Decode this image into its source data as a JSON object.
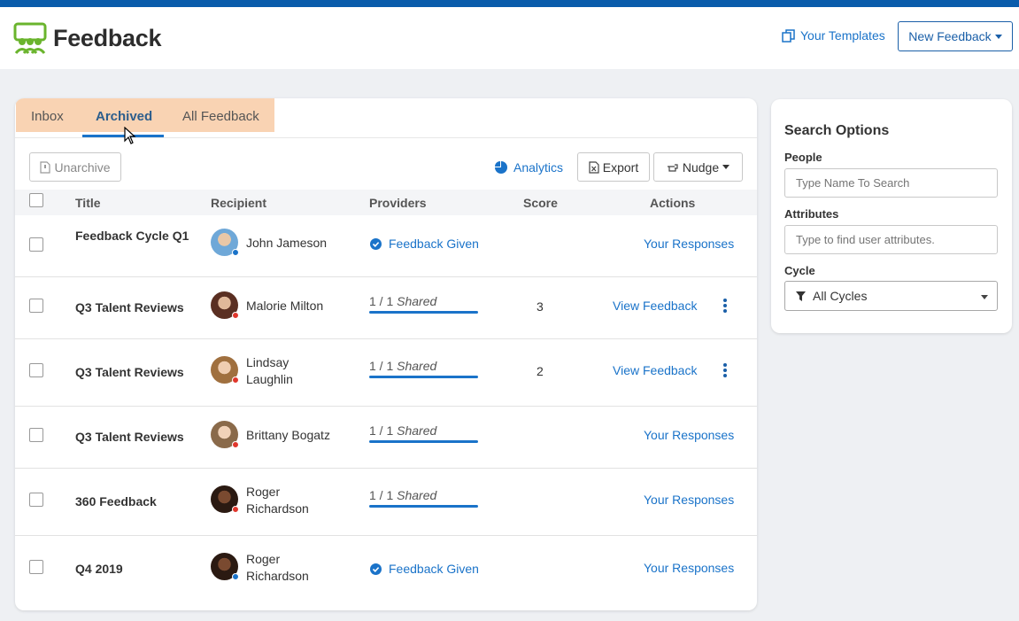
{
  "app": {
    "title": "Feedback"
  },
  "header": {
    "templates_label": "Your Templates",
    "new_feedback_label": "New Feedback"
  },
  "tabs": [
    {
      "label": "Inbox",
      "active": false
    },
    {
      "label": "Archived",
      "active": true
    },
    {
      "label": "All Feedback",
      "active": false
    }
  ],
  "toolbar": {
    "unarchive_label": "Unarchive",
    "analytics_label": "Analytics",
    "export_label": "Export",
    "nudge_label": "Nudge"
  },
  "table": {
    "columns": [
      "Title",
      "Recipient",
      "Providers",
      "Score",
      "Actions"
    ],
    "rows": [
      {
        "title": "Feedback Cycle Q1",
        "recipient": "John Jameson",
        "status_dot": "#1a73c9",
        "providers": "Feedback Given",
        "score": "",
        "action": "Your Responses"
      },
      {
        "title": "Q3 Talent Reviews",
        "recipient": "Malorie Milton",
        "status_dot": "#e0362c",
        "providers_shared": "1 / 1",
        "providers_label": "Shared",
        "score": "3",
        "action": "View Feedback"
      },
      {
        "title": "Q3 Talent Reviews",
        "recipient": "Lindsay Laughlin",
        "status_dot": "#e0362c",
        "providers_shared": "1 / 1",
        "providers_label": "Shared",
        "score": "2",
        "action": "View Feedback"
      },
      {
        "title": "Q3 Talent Reviews",
        "recipient": "Brittany Bogatz",
        "status_dot": "#e0362c",
        "providers_shared": "1 / 1",
        "providers_label": "Shared",
        "score": "",
        "action": "Your Responses"
      },
      {
        "title": "360 Feedback",
        "recipient": "Roger Richardson",
        "status_dot": "#e0362c",
        "providers_shared": "1 / 1",
        "providers_label": "Shared",
        "score": "",
        "action": "Your Responses"
      },
      {
        "title": "Q4 2019",
        "recipient": "Roger Richardson",
        "status_dot": "#1a73c9",
        "providers": "Feedback Given",
        "score": "",
        "action": "Your Responses"
      }
    ]
  },
  "search": {
    "title": "Search Options",
    "people_label": "People",
    "people_placeholder": "Type Name To Search",
    "attributes_label": "Attributes",
    "attributes_placeholder": "Type to find user attributes.",
    "cycle_label": "Cycle",
    "cycle_value": "All Cycles"
  },
  "colors": {
    "brand_bar": "#0a5cab",
    "link": "#1a73c9",
    "tab_highlight": "#f9d3b3",
    "logo_green": "#6ab42d"
  }
}
